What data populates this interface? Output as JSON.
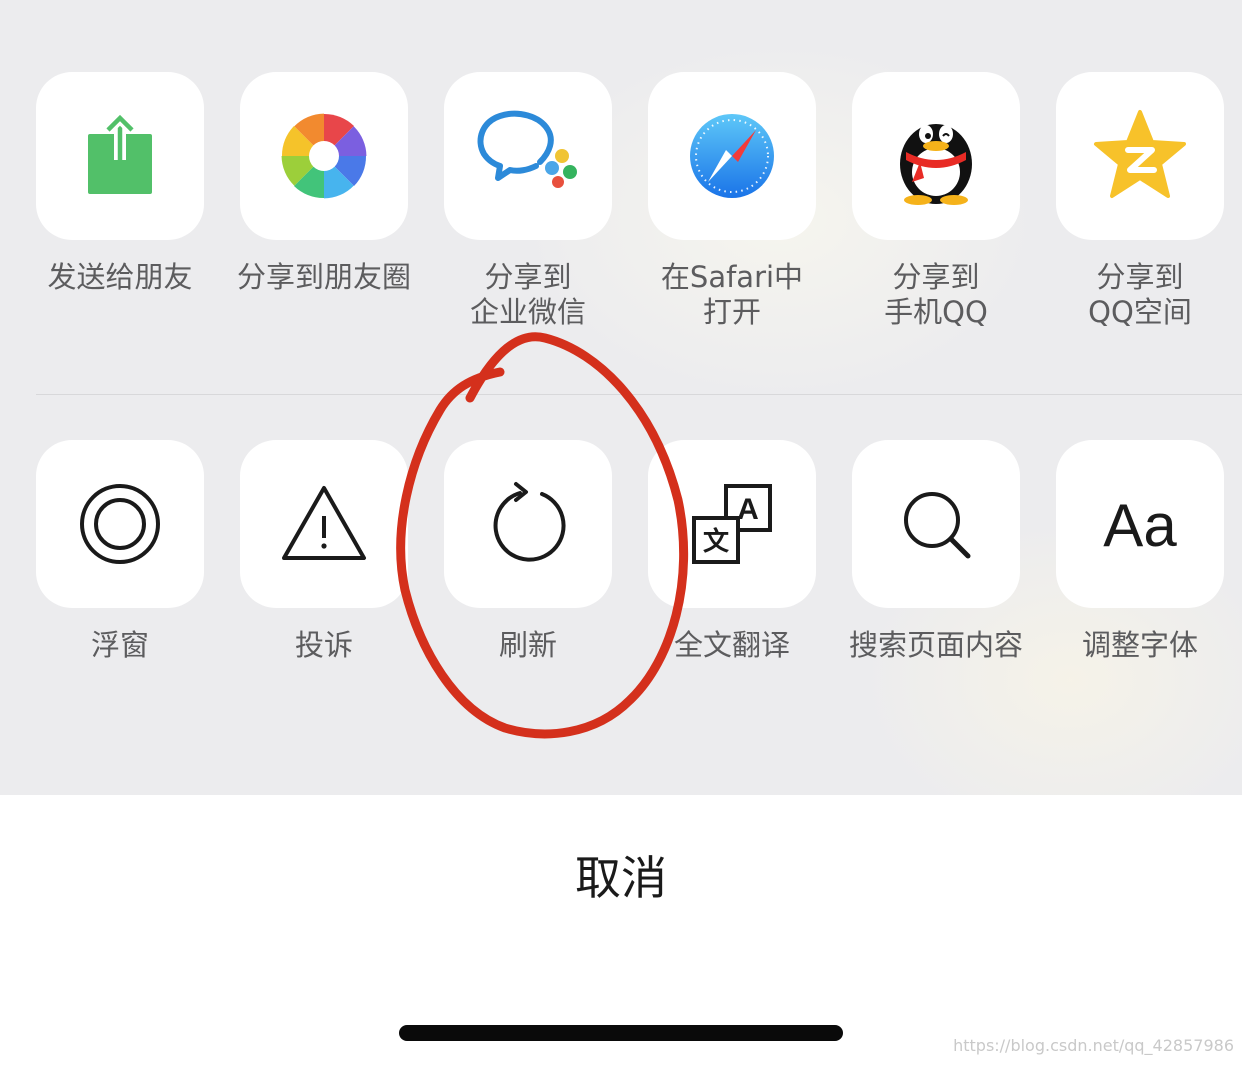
{
  "share_row": [
    {
      "label_lines": [
        "发送给朋友"
      ],
      "icon": "share-export-icon"
    },
    {
      "label_lines": [
        "分享到朋友圈"
      ],
      "icon": "moments-shutter-icon"
    },
    {
      "label_lines": [
        "分享到",
        "企业微信"
      ],
      "icon": "wecom-icon"
    },
    {
      "label_lines": [
        "在Safari中",
        "打开"
      ],
      "icon": "safari-compass-icon"
    },
    {
      "label_lines": [
        "分享到",
        "手机QQ"
      ],
      "icon": "qq-penguin-icon"
    },
    {
      "label_lines": [
        "分享到",
        "QQ空间"
      ],
      "icon": "qzone-star-icon"
    }
  ],
  "action_row": [
    {
      "label": "浮窗",
      "icon": "floating-window-icon"
    },
    {
      "label": "投诉",
      "icon": "warning-icon"
    },
    {
      "label": "刷新",
      "icon": "refresh-icon"
    },
    {
      "label": "全文翻译",
      "icon": "translate-icon",
      "glyphs": [
        "文",
        "A"
      ]
    },
    {
      "label": "搜索页面内容",
      "icon": "search-icon"
    },
    {
      "label": "调整字体",
      "icon": "font-size-icon",
      "glyph": "Aa"
    }
  ],
  "cancel_label": "取消",
  "watermark": "https://blog.csdn.net/qq_42857986",
  "colors": {
    "sheet_background": "#ececee",
    "tile_background": "#ffffff",
    "label_text": "#5c5c5e",
    "annotation_red": "#d4301c"
  }
}
